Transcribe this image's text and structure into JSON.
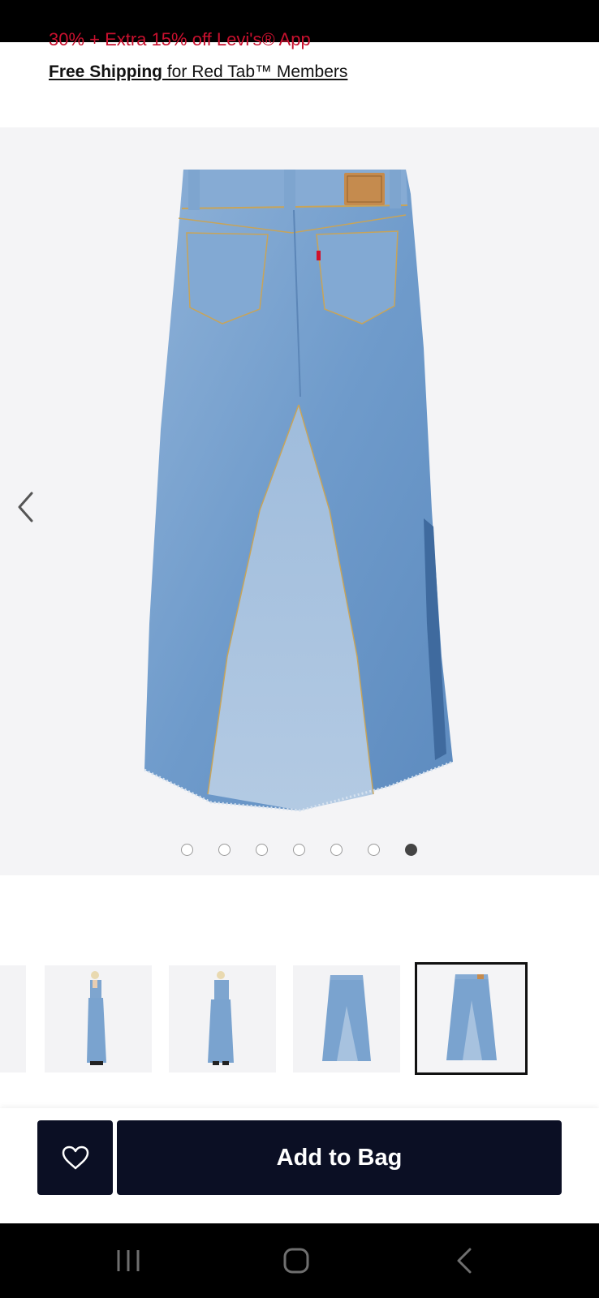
{
  "promo": {
    "partial_text": "30% + Extra 15% off Levi's® App"
  },
  "shipping": {
    "link_text": "Free Shipping",
    "rest_text": " for Red Tab™ Members"
  },
  "gallery": {
    "image_count": 7,
    "active_index": 6,
    "selected_thumbnail_index": 3
  },
  "actions": {
    "add_to_bag_label": "Add to Bag"
  },
  "colors": {
    "promo_red": "#c8102e",
    "button_navy": "#0b0f24",
    "denim_mid": "#7aa3cf",
    "denim_light": "#a7c2df"
  },
  "icons": {
    "prev": "chevron-left-icon",
    "favorite": "heart-outline-icon",
    "recents": "recent-apps-icon",
    "home": "home-icon",
    "back": "back-icon"
  }
}
